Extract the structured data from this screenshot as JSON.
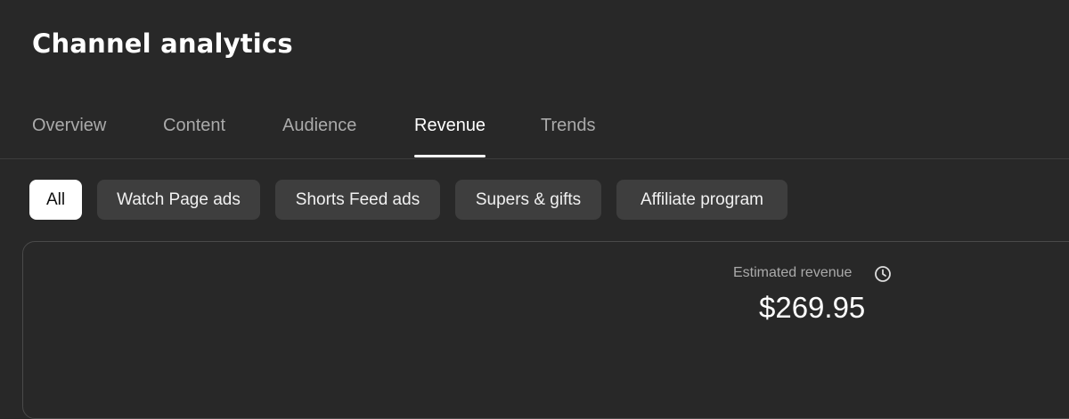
{
  "header": {
    "title": "Channel analytics"
  },
  "tabs": [
    {
      "label": "Overview",
      "active": false
    },
    {
      "label": "Content",
      "active": false
    },
    {
      "label": "Audience",
      "active": false
    },
    {
      "label": "Revenue",
      "active": true
    },
    {
      "label": "Trends",
      "active": false
    }
  ],
  "chips": [
    {
      "label": "All",
      "active": true
    },
    {
      "label": "Watch Page ads",
      "active": false
    },
    {
      "label": "Shorts Feed ads",
      "active": false
    },
    {
      "label": "Supers & gifts",
      "active": false
    },
    {
      "label": "Affiliate program",
      "active": false
    }
  ],
  "metric": {
    "label": "Estimated revenue",
    "value": "$269.95",
    "icon": "clock-icon"
  },
  "colors": {
    "background": "#282828",
    "tab_inactive": "#aaaaaa",
    "chip_background": "#3e3e3e",
    "chip_active_background": "#ffffff"
  }
}
